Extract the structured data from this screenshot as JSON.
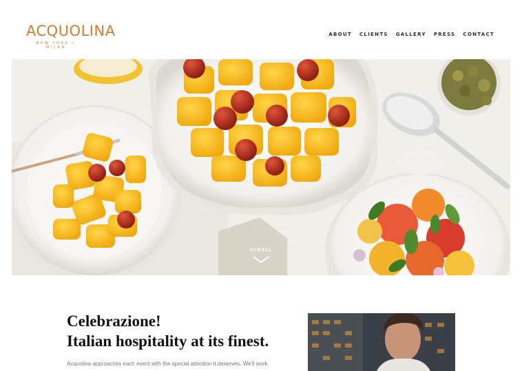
{
  "brand": {
    "name": "ACQUOLINA",
    "tagline": "NEW YORK • MILAN",
    "accent_color": "#d47a2c"
  },
  "nav": {
    "items": [
      {
        "label": "ABOUT"
      },
      {
        "label": "CLIENTS"
      },
      {
        "label": "GALLERY"
      },
      {
        "label": "PRESS"
      },
      {
        "label": "CONTACT"
      }
    ]
  },
  "hero": {
    "scroll_label": "SCROLL",
    "scroll_icon": "chevron-down-icon"
  },
  "intro": {
    "heading_line1": "Celebrazione!",
    "heading_line2": "Italian hospitality at its finest.",
    "body": "Acquolina approaches each event with the special attention it deserves. We'll work"
  }
}
